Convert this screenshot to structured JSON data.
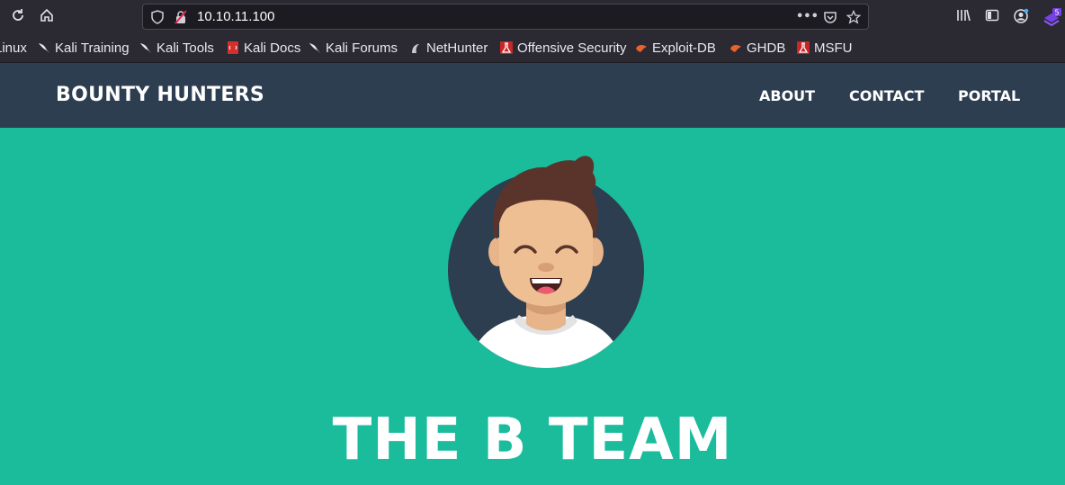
{
  "browser": {
    "url": "10.10.11.100",
    "icons": [
      "reload-icon",
      "home-icon",
      "shield-icon",
      "insecure-lock-icon",
      "more-icon",
      "pocket-icon",
      "star-icon",
      "library-icon",
      "sidebar-icon",
      "account-icon",
      "extension-icon"
    ],
    "extension_badge": "5"
  },
  "bookmarks": [
    {
      "label": "Linux",
      "icon": "none"
    },
    {
      "label": "Kali Training",
      "icon": "kali-dragon-icon"
    },
    {
      "label": "Kali Tools",
      "icon": "kali-dragon-icon"
    },
    {
      "label": "Kali Docs",
      "icon": "kali-docs-icon"
    },
    {
      "label": "Kali Forums",
      "icon": "kali-dragon-icon"
    },
    {
      "label": "NetHunter",
      "icon": "nethunter-icon"
    },
    {
      "label": "Offensive Security",
      "icon": "offsec-icon"
    },
    {
      "label": "Exploit-DB",
      "icon": "exploitdb-icon"
    },
    {
      "label": "GHDB",
      "icon": "exploitdb-icon"
    },
    {
      "label": "MSFU",
      "icon": "offsec-icon"
    }
  ],
  "site": {
    "brand": "BOUNTY HUNTERS",
    "nav": [
      "ABOUT",
      "CONTACT",
      "PORTAL"
    ],
    "hero_title": "THE B TEAM"
  },
  "colors": {
    "nav_bg": "#2c3e50",
    "hero_bg": "#1abc9c",
    "browser_bg": "#2b2a33"
  }
}
